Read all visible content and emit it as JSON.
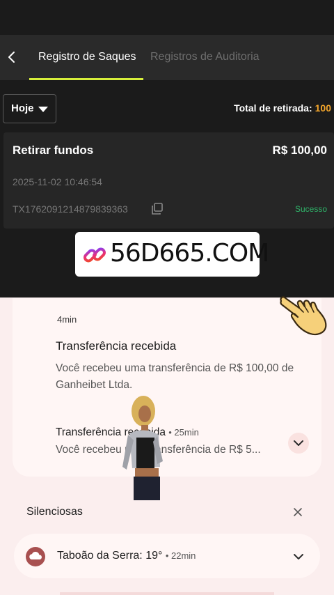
{
  "header": {
    "tabs": [
      {
        "label": "Registro de Saques",
        "active": true
      },
      {
        "label": "Registros de Auditoria",
        "active": false
      }
    ]
  },
  "filter": {
    "label": "Hoje"
  },
  "total": {
    "label": "Total de retirada:",
    "value": "100"
  },
  "record": {
    "title": "Retirar fundos",
    "amount": "R$ 100,00",
    "datetime": "2025-11-02 10:46:54",
    "transaction_id": "TX1762091214879839363",
    "status": "Sucesso"
  },
  "promo": {
    "text": "56D665.COM"
  },
  "notifications": {
    "first": {
      "time": "4min",
      "title": "Transferência recebida",
      "body": "Você recebeu uma transferência de R$ 100,00 de Ganheibet Ltda."
    },
    "second": {
      "title": "Transferência recebida",
      "meta": "• 25min",
      "body": "Você recebeu uma transferência de R$ 5..."
    }
  },
  "silent": {
    "label": "Silenciosas"
  },
  "weather": {
    "text": "Taboão da Serra: 19°",
    "meta": "• 22min"
  },
  "colors": {
    "accent": "#d7ef3b",
    "total_value": "#f3a52b",
    "success": "#2fb369",
    "app_bg": "#1b1b1b",
    "notification_bg": "#fbeeee"
  }
}
